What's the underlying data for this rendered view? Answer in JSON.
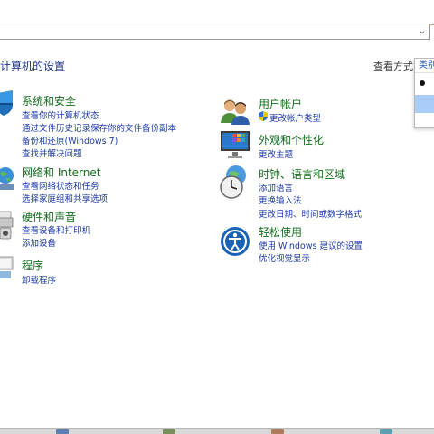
{
  "address": {
    "dropdown_glyph": "⌄"
  },
  "page": {
    "title": "计算机的设置"
  },
  "viewby": {
    "label": "查看方式:",
    "selected": "类别"
  },
  "left_categories": [
    {
      "title": "系统和安全",
      "links": [
        "查看你的计算机状态",
        "通过文件历史记录保存你的文件备份副本",
        "备份和还原(Windows 7)",
        "查找并解决问题"
      ]
    },
    {
      "title": "网络和 Internet",
      "links": [
        "查看网络状态和任务",
        "选择家庭组和共享选项"
      ]
    },
    {
      "title": "硬件和声音",
      "links": [
        "查看设备和打印机",
        "添加设备"
      ]
    },
    {
      "title": "程序",
      "links": [
        "卸载程序"
      ]
    }
  ],
  "right_categories": [
    {
      "title": "用户帐户",
      "links": [
        "更改帐户类型"
      ]
    },
    {
      "title": "外观和个性化",
      "links": [
        "更改主题"
      ]
    },
    {
      "title": "时钟、语言和区域",
      "links": [
        "添加语言",
        "更换输入法",
        "更改日期、时间或数字格式"
      ]
    },
    {
      "title": "轻松使用",
      "links": [
        "使用 Windows 建议的设置",
        "优化视觉显示"
      ]
    }
  ],
  "colors": {
    "title_green": "#146c1e",
    "link_blue": "#1e3aa8",
    "header_blue": "#1e3287",
    "selection": "#a9cdf6"
  }
}
